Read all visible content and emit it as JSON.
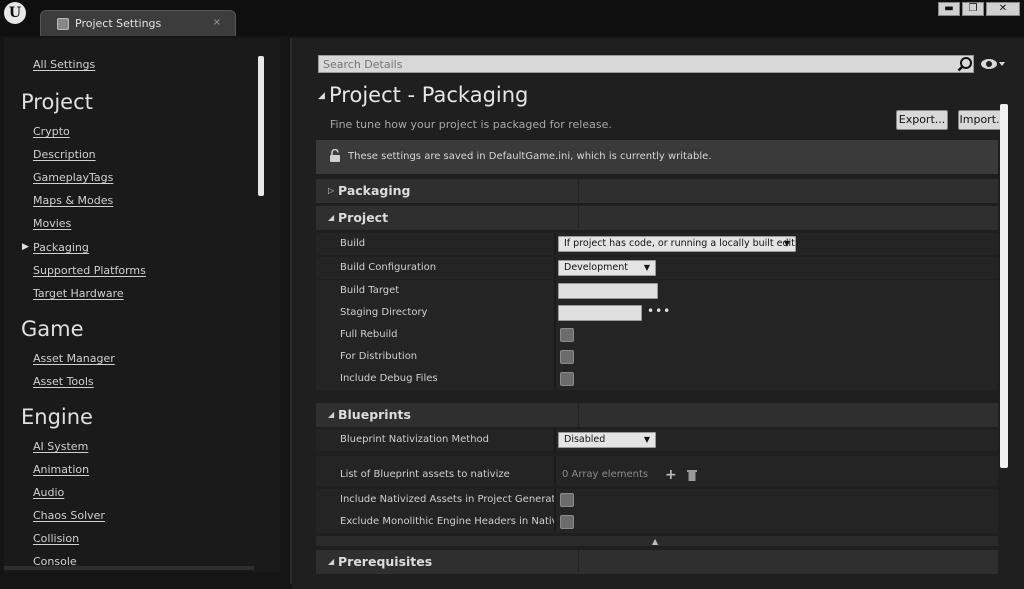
{
  "window": {
    "logo": "U",
    "tab_title": "Project Settings",
    "tab_close": "×",
    "minimize": "▬",
    "maximize": "❐",
    "close": "✕"
  },
  "sidebar": {
    "all_settings": "All Settings",
    "sections": [
      {
        "title": "Project",
        "items": [
          "Crypto",
          "Description",
          "GameplayTags",
          "Maps & Modes",
          "Movies",
          "Packaging",
          "Supported Platforms",
          "Target Hardware"
        ]
      },
      {
        "title": "Game",
        "items": [
          "Asset Manager",
          "Asset Tools"
        ]
      },
      {
        "title": "Engine",
        "items": [
          "AI System",
          "Animation",
          "Audio",
          "Chaos Solver",
          "Collision",
          "Console"
        ]
      }
    ],
    "selected_item": "Packaging"
  },
  "main": {
    "search_placeholder": "Search Details",
    "title": "Project - Packaging",
    "subtitle": "Fine tune how your project is packaged for release.",
    "export_label": "Export...",
    "import_label": "Import...",
    "info_text": "These settings are saved in DefaultGame.ini, which is currently writable.",
    "categories": {
      "packaging": "Packaging",
      "project": "Project",
      "blueprints": "Blueprints",
      "prerequisites": "Prerequisites"
    },
    "project_rows": {
      "build_label": "Build",
      "build_value": "If project has code, or running a locally built editor",
      "build_config_label": "Build Configuration",
      "build_config_value": "Development",
      "build_target_label": "Build Target",
      "build_target_value": "",
      "staging_dir_label": "Staging Directory",
      "staging_dir_value": "",
      "staging_dir_browse": "•••",
      "full_rebuild_label": "Full Rebuild",
      "for_distribution_label": "For Distribution",
      "include_debug_label": "Include Debug Files"
    },
    "blueprint_rows": {
      "nativization_label": "Blueprint Nativization Method",
      "nativization_value": "Disabled",
      "assets_list_label": "List of Blueprint assets to nativize",
      "assets_list_value": "0 Array elements",
      "include_nativized_label": "Include Nativized Assets in Project Generation",
      "exclude_headers_label": "Exclude Monolithic Engine Headers in Nativized Code"
    }
  },
  "colors": {
    "background": "#1f1f1f",
    "category_bg": "#2f2f2f",
    "row_bg": "#242424",
    "input_bg": "#e4e4e4"
  }
}
